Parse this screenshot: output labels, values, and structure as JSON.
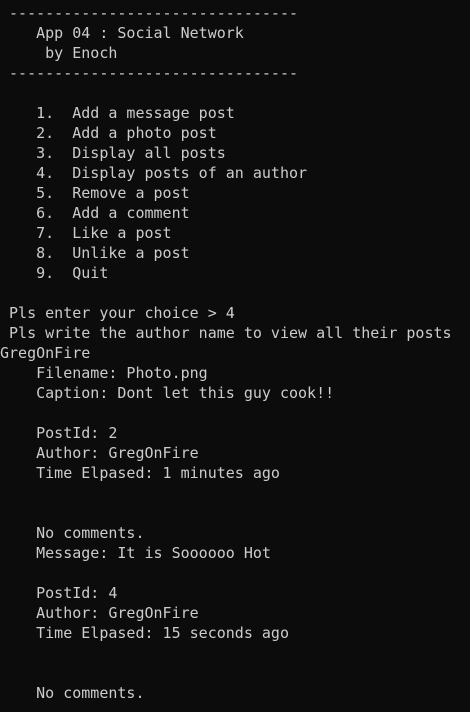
{
  "console": {
    "lines": [
      " --------------------------------",
      "    App 04 : Social Network",
      "     by Enoch",
      " --------------------------------",
      "",
      "    1.  Add a message post",
      "    2.  Add a photo post",
      "    3.  Display all posts",
      "    4.  Display posts of an author",
      "    5.  Remove a post",
      "    6.  Add a comment",
      "    7.  Like a post",
      "    8.  Unlike a post",
      "    9.  Quit",
      "",
      " Pls enter your choice > 4",
      " Pls write the author name to view all their posts",
      "GregOnFire",
      "    Filename: Photo.png",
      "    Caption: Dont let this guy cook!!",
      "",
      "    PostId: 2",
      "    Author: GregOnFire",
      "    Time Elpased: 1 minutes ago",
      "",
      "",
      "    No comments.",
      "    Message: It is Soooooo Hot",
      "",
      "    PostId: 4",
      "    Author: GregOnFire",
      "    Time Elpased: 15 seconds ago",
      "",
      "",
      "    No comments."
    ]
  }
}
